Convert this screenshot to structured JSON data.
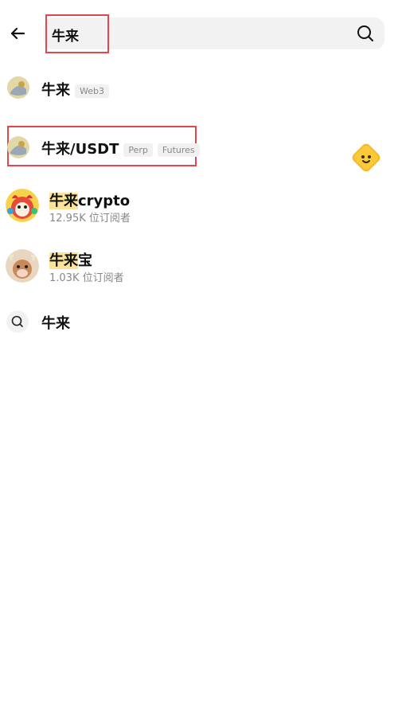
{
  "search": {
    "query": "牛来"
  },
  "results": [
    {
      "title": "牛来",
      "tags": [
        "Web3"
      ]
    },
    {
      "title": "牛来/USDT",
      "tags": [
        "Perp",
        "Futures"
      ]
    },
    {
      "title_hl": "牛来",
      "title_rest": "crypto",
      "subtitle": "12.95K 位订阅者"
    },
    {
      "title_hl": "牛来",
      "title_rest": "宝",
      "subtitle": "1.03K 位订阅者"
    }
  ],
  "suggestion": {
    "text": "牛来"
  },
  "colors": {
    "accent_red": "#e0484e",
    "highlight": "#fbe49a",
    "emoji": "#f7b927"
  },
  "icons": [
    "back-arrow-icon",
    "search-icon",
    "emoji-face-icon",
    "search-small-icon"
  ]
}
